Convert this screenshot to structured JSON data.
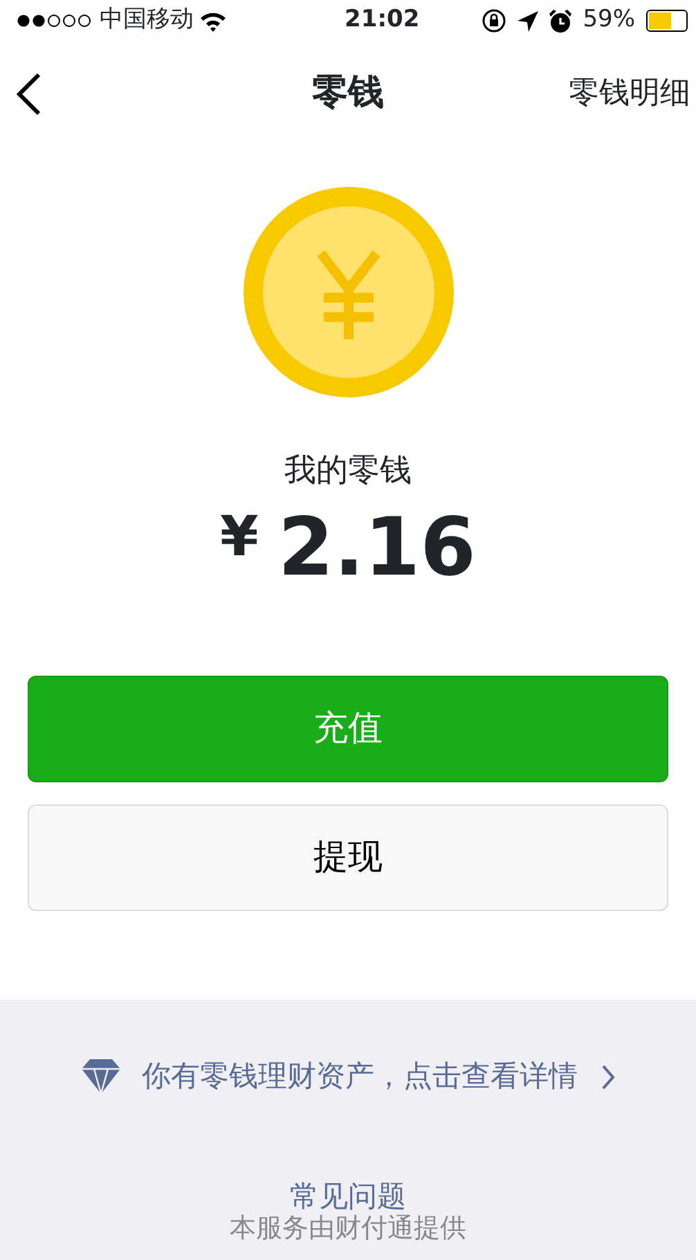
{
  "status_bar": {
    "carrier": "中国移动",
    "time": "21:02",
    "battery_percent": "59%"
  },
  "nav": {
    "title": "零钱",
    "action": "零钱明细"
  },
  "balance": {
    "label": "我的零钱",
    "currency": "¥",
    "amount": "2.16"
  },
  "buttons": [
    {
      "label": "充值",
      "kind": "primary"
    },
    {
      "label": "提现",
      "kind": "secondary"
    }
  ],
  "promo": {
    "text": "你有零钱理财资产，点击查看详情"
  },
  "footer": {
    "link": "常见问题",
    "note": "本服务由财付通提供"
  }
}
